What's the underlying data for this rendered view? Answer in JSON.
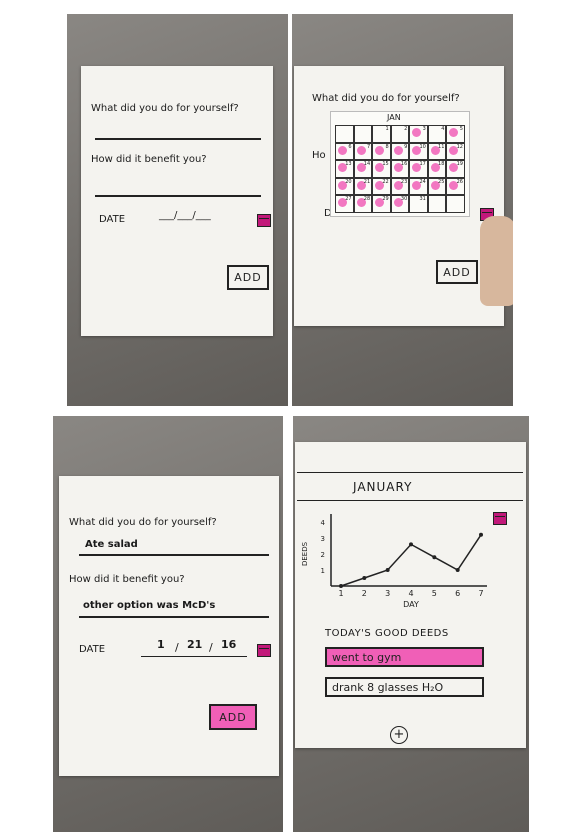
{
  "form": {
    "question1": "What did you do for yourself?",
    "question2": "How did it benefit you?",
    "date_label": "DATE",
    "date_placeholder": "___/___/___",
    "add_label": "ADD",
    "calendar_icon": "calendar-icon"
  },
  "calendar": {
    "month": "JAN",
    "days": [
      "",
      "",
      "1",
      "2",
      "3",
      "4",
      "5",
      "6",
      "7",
      "8",
      "9",
      "10",
      "11",
      "12",
      "13",
      "14",
      "15",
      "16",
      "17",
      "18",
      "19",
      "20",
      "21",
      "22",
      "23",
      "24",
      "25",
      "26",
      "27",
      "28",
      "29",
      "30",
      "31",
      "",
      ""
    ],
    "highlight_color": "#f05fb7"
  },
  "filled_form": {
    "answer1": "Ate salad",
    "answer2": "other option was McD's",
    "date_month": "1",
    "date_day": "21",
    "date_year": "16",
    "add_highlight_color": "#f05fb7"
  },
  "summary": {
    "month_title": "JANUARY",
    "todays_label": "TODAY'S GOOD DEEDS",
    "deeds": [
      {
        "text": "went to gym",
        "highlighted": true
      },
      {
        "text": "drank 8 glasses H₂O",
        "highlighted": false
      }
    ],
    "add_icon": "plus-circle-icon"
  },
  "chart_data": {
    "type": "line",
    "xlabel": "DAY",
    "ylabel": "DEEDS",
    "x": [
      1,
      2,
      3,
      4,
      5,
      6,
      7
    ],
    "values": [
      0,
      0.5,
      1,
      2.6,
      1.8,
      1,
      3.2
    ],
    "x_ticks": [
      "1",
      "2",
      "3",
      "4",
      "5",
      "6",
      "7"
    ],
    "y_ticks": [
      "1",
      "2",
      "3",
      "4"
    ],
    "ylim": [
      0,
      4
    ],
    "xlim": [
      1,
      7
    ],
    "grid": false
  }
}
